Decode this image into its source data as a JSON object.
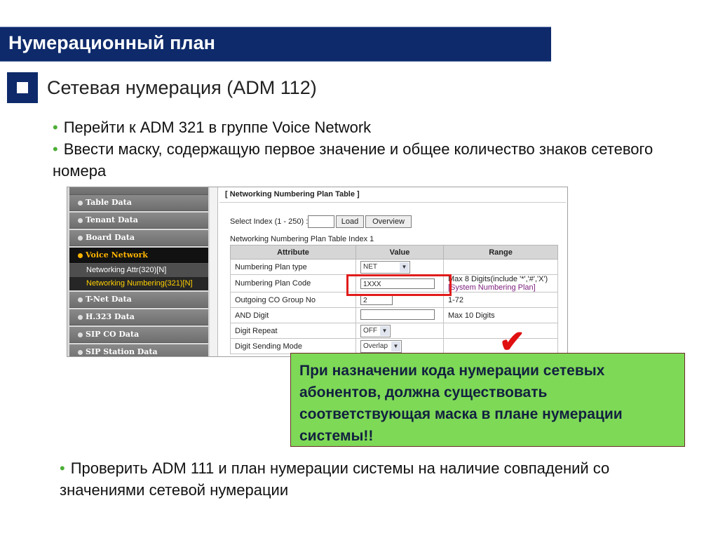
{
  "slide": {
    "title": "Нумерационный план",
    "subheading": "Сетевая нумерация (ADM 112)",
    "bullets": [
      "Перейти к ADM 321 в группе Voice Network",
      "Ввести маску, содержащую первое значение и общее количество знаков сетевого номера"
    ],
    "bullet3": "Проверить ADM 111 и план нумерации системы на наличие совпадений со значениями сетевой нумерации",
    "note": {
      "lines": [
        "При назначении кода нумерации сетевых",
        "абонентов, должна существовать",
        "соответствующая маска в плане нумерации",
        "системы!!"
      ]
    },
    "check_icon": "checkmark-icon",
    "colors": {
      "title_bg": "#0e2a6b",
      "bullet_dot": "#4cae36",
      "note_bg": "#7ed957",
      "highlight": "#e11c1c"
    }
  },
  "screenshot": {
    "nav": {
      "items": [
        {
          "label": "Table Data"
        },
        {
          "label": "Tenant Data"
        },
        {
          "label": "Board Data"
        },
        {
          "label": "Voice Network"
        },
        {
          "label": "T-Net Data"
        },
        {
          "label": "H.323 Data"
        },
        {
          "label": "SIP CO Data"
        },
        {
          "label": "SIP Station Data"
        }
      ],
      "sub_items": [
        {
          "label": "Networking Attr(320)[N]"
        },
        {
          "label": "Networking Numbering(321)[N]"
        }
      ]
    },
    "content": {
      "title": "[ Networking Numbering Plan Table ]",
      "select_label": "Select Index (1 - 250) :",
      "select_value": "",
      "load_label": "Load",
      "overview_label": "Overview",
      "index_label": "Networking Numbering Plan Table Index 1",
      "table": {
        "headers": [
          "Attribute",
          "Value",
          "Range"
        ],
        "rows": [
          {
            "attribute": "Numbering Plan type",
            "value": "NET",
            "control": "select",
            "range": ""
          },
          {
            "attribute": "Numbering Plan Code",
            "value": "1XXX",
            "control": "text",
            "range": "Max 8 Digits(include '*','#','X')",
            "range_sub": "[System Numbering Plan]"
          },
          {
            "attribute": "Outgoing CO Group No",
            "value": "2",
            "control": "text",
            "range": "1-72"
          },
          {
            "attribute": "AND Digit",
            "value": "",
            "control": "text",
            "range": "Max 10 Digits"
          },
          {
            "attribute": "Digit Repeat",
            "value": "OFF",
            "control": "select",
            "range": ""
          },
          {
            "attribute": "Digit Sending Mode",
            "value": "Overlap",
            "control": "select",
            "range": ""
          }
        ]
      }
    }
  }
}
